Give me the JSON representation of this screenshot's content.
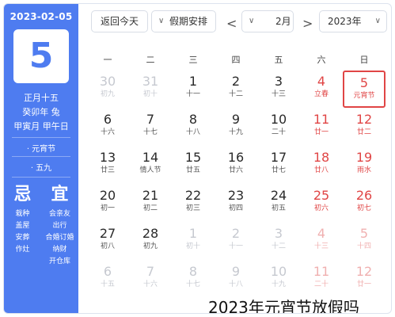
{
  "sidebar": {
    "date": "2023-02-05",
    "day": "5",
    "lunar_date": "正月十五",
    "ganzhi_year": "癸卯年 兔",
    "ganzhi_month_day": "甲寅月 甲午日",
    "festival1": "· 元宵节",
    "festival2": "· 五九",
    "yi_label": "宜",
    "ji_label": "忌",
    "yi_items": [
      "会亲友",
      "出行",
      "合婚订婚",
      "纳财",
      "开仓库"
    ],
    "ji_items": [
      "栽种",
      "盖屋",
      "安葬",
      "作灶"
    ]
  },
  "header": {
    "back_today": "返回今天",
    "holiday_select": "假期安排",
    "month_select": "2月",
    "year_select": "2023年",
    "prev_arrow": "<",
    "next_arrow": ">"
  },
  "weekdays": [
    "一",
    "二",
    "三",
    "四",
    "五",
    "六",
    "日"
  ],
  "weeks": [
    [
      {
        "n": "30",
        "l": "初九",
        "other": true
      },
      {
        "n": "31",
        "l": "初十",
        "other": true
      },
      {
        "n": "1",
        "l": "十一"
      },
      {
        "n": "2",
        "l": "十二"
      },
      {
        "n": "3",
        "l": "十三"
      },
      {
        "n": "4",
        "l": "立春",
        "weekend": true
      },
      {
        "n": "5",
        "l": "元宵节",
        "weekend": true,
        "selected": true
      }
    ],
    [
      {
        "n": "6",
        "l": "十六"
      },
      {
        "n": "7",
        "l": "十七"
      },
      {
        "n": "8",
        "l": "十八"
      },
      {
        "n": "9",
        "l": "十九"
      },
      {
        "n": "10",
        "l": "二十"
      },
      {
        "n": "11",
        "l": "廿一",
        "weekend": true
      },
      {
        "n": "12",
        "l": "廿二",
        "weekend": true
      }
    ],
    [
      {
        "n": "13",
        "l": "廿三"
      },
      {
        "n": "14",
        "l": "情人节"
      },
      {
        "n": "15",
        "l": "廿五"
      },
      {
        "n": "16",
        "l": "廿六"
      },
      {
        "n": "17",
        "l": "廿七"
      },
      {
        "n": "18",
        "l": "廿八",
        "weekend": true
      },
      {
        "n": "19",
        "l": "雨水",
        "weekend": true
      }
    ],
    [
      {
        "n": "20",
        "l": "初一"
      },
      {
        "n": "21",
        "l": "初二"
      },
      {
        "n": "22",
        "l": "初三"
      },
      {
        "n": "23",
        "l": "初四"
      },
      {
        "n": "24",
        "l": "初五"
      },
      {
        "n": "25",
        "l": "初六",
        "weekend": true
      },
      {
        "n": "26",
        "l": "初七",
        "weekend": true
      }
    ],
    [
      {
        "n": "27",
        "l": "初八"
      },
      {
        "n": "28",
        "l": "初九"
      },
      {
        "n": "1",
        "l": "初十",
        "other": true
      },
      {
        "n": "2",
        "l": "十一",
        "other": true
      },
      {
        "n": "3",
        "l": "十二",
        "other": true
      },
      {
        "n": "4",
        "l": "十三",
        "other": true,
        "weekend": true
      },
      {
        "n": "5",
        "l": "十四",
        "other": true,
        "weekend": true
      }
    ],
    [
      {
        "n": "6",
        "l": "十五",
        "other": true
      },
      {
        "n": "7",
        "l": "十六",
        "other": true
      },
      {
        "n": "8",
        "l": "十七",
        "other": true
      },
      {
        "n": "9",
        "l": "十八",
        "other": true
      },
      {
        "n": "10",
        "l": "十九",
        "other": true
      },
      {
        "n": "11",
        "l": "二十",
        "other": true,
        "weekend": true
      },
      {
        "n": "12",
        "l": "廿一",
        "other": true,
        "weekend": true
      }
    ]
  ],
  "caption": "2023年元宵节放假吗",
  "colors": {
    "sidebar": "#4e7cf0",
    "weekend": "#e04545",
    "selected_border": "#e04545"
  }
}
